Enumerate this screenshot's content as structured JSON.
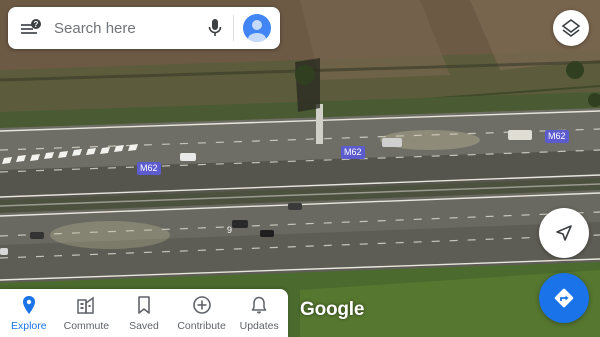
{
  "search": {
    "placeholder": "Search here",
    "has_notification_badge": true
  },
  "map": {
    "view": "satellite",
    "road_shields": [
      {
        "id": "left",
        "text": "M62"
      },
      {
        "id": "center",
        "text": "M62"
      },
      {
        "id": "right",
        "text": "M62"
      }
    ],
    "lane_marker": "9",
    "attribution": "Google"
  },
  "bottom_nav": {
    "items": [
      {
        "label": "Explore",
        "icon": "pin-icon",
        "active": true
      },
      {
        "label": "Commute",
        "icon": "commute-icon",
        "active": false
      },
      {
        "label": "Saved",
        "icon": "bookmark-icon",
        "active": false
      },
      {
        "label": "Contribute",
        "icon": "add-circle-icon",
        "active": false
      },
      {
        "label": "Updates",
        "icon": "bell-icon",
        "active": false
      }
    ]
  },
  "colors": {
    "accent": "#1a73e8",
    "shield": "#5c5ccf",
    "inactive_text": "#5f6368"
  }
}
